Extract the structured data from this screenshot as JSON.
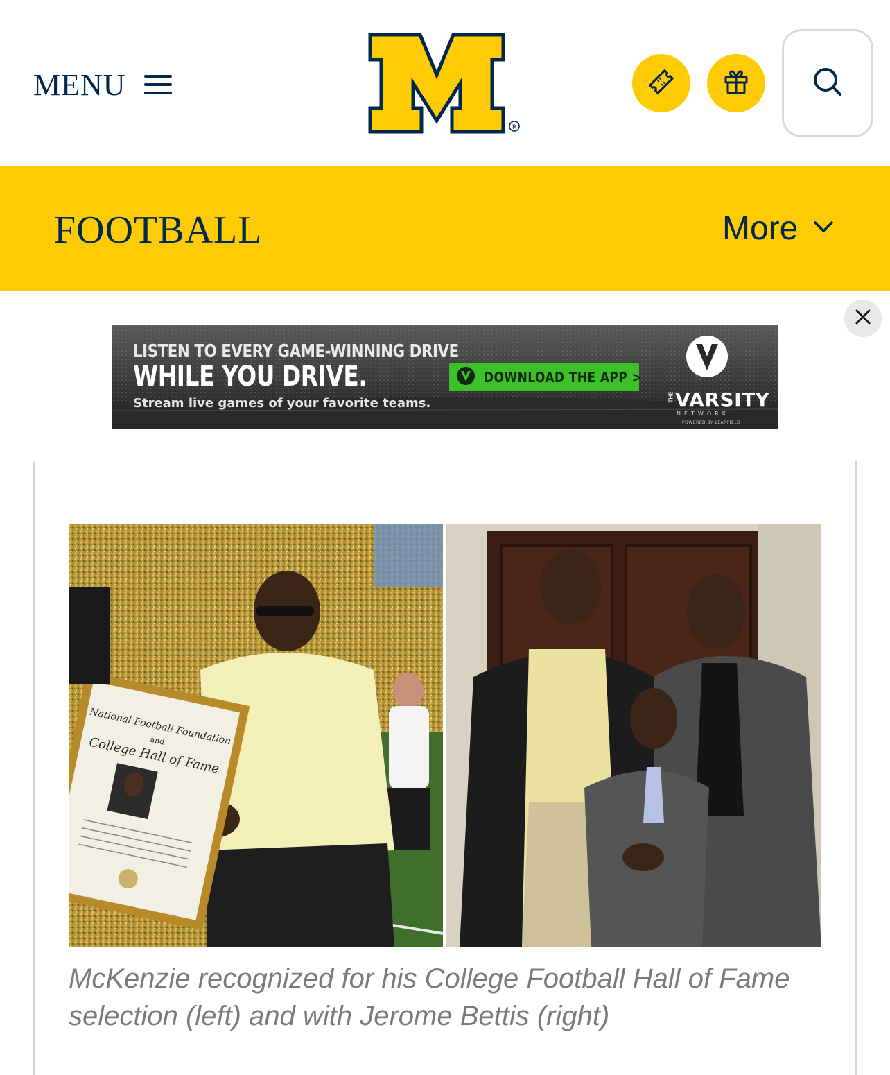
{
  "header": {
    "menu_label": "MENU",
    "logo_name": "Block M logo",
    "icons": [
      "ticket-icon",
      "gift-icon",
      "search-icon"
    ]
  },
  "sportbar": {
    "title": "FOOTBALL",
    "more_label": "More"
  },
  "ad": {
    "line1": "LISTEN TO EVERY GAME-WINNING DRIVE",
    "line2": "WHILE YOU DRIVE.",
    "line3": "Stream live games of your favorite teams.",
    "cta": "DOWNLOAD THE APP >",
    "brand_the": "THE",
    "brand": "VARSITY",
    "brand_sub": "NETWORK",
    "brand_powered": "POWERED BY LEARFIELD"
  },
  "article": {
    "photo_left_plaque_lines": [
      "National Football Foundation",
      "and",
      "College Hall of Fame"
    ],
    "caption": "McKenzie recognized for his College Football Hall of Fame selection (left) and with Jerome Bettis (right)"
  },
  "colors": {
    "maize": "#ffcb05",
    "blue": "#00274c",
    "ad_green": "#3ec02a",
    "caption_gray": "#7a7a7a"
  }
}
